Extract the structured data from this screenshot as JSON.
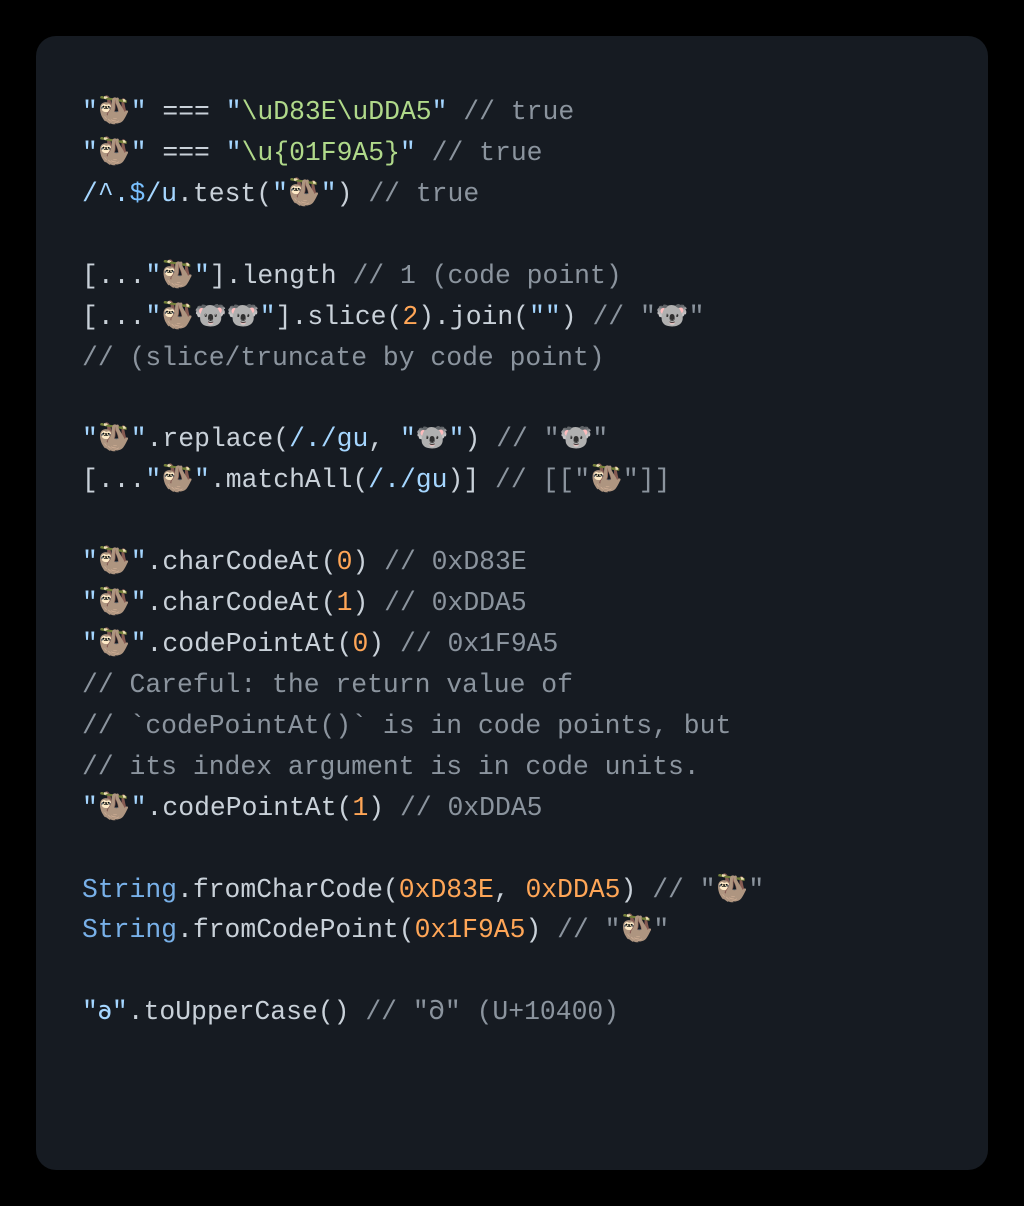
{
  "colors": {
    "bg_outer": "#000000",
    "bg_panel": "#161b22",
    "text_default": "#c9d1d9",
    "text_comment": "#8b949e",
    "text_string": "#a5d6ff",
    "text_escape": "#b0d98a",
    "text_number": "#ffa657",
    "text_constant": "#79c0ff",
    "text_class": "#78b0e8"
  },
  "lines": [
    [
      {
        "t": "str",
        "v": "\"🦥\""
      },
      {
        "t": "punct",
        "v": " === "
      },
      {
        "t": "str",
        "v": "\""
      },
      {
        "t": "esc",
        "v": "\\uD83E\\uDDA5"
      },
      {
        "t": "str",
        "v": "\""
      },
      {
        "t": "comment",
        "v": " // true"
      }
    ],
    [
      {
        "t": "str",
        "v": "\"🦥\""
      },
      {
        "t": "punct",
        "v": " === "
      },
      {
        "t": "str",
        "v": "\""
      },
      {
        "t": "esc",
        "v": "\\u{01F9A5}"
      },
      {
        "t": "str",
        "v": "\""
      },
      {
        "t": "comment",
        "v": " // true"
      }
    ],
    [
      {
        "t": "regex",
        "v": "/^."
      },
      {
        "t": "const",
        "v": "$"
      },
      {
        "t": "regex",
        "v": "/u"
      },
      {
        "t": "punct",
        "v": "."
      },
      {
        "t": "prop",
        "v": "test"
      },
      {
        "t": "punct",
        "v": "("
      },
      {
        "t": "str",
        "v": "\"🦥\""
      },
      {
        "t": "punct",
        "v": ")"
      },
      {
        "t": "comment",
        "v": " // true"
      }
    ],
    [],
    [
      {
        "t": "punct",
        "v": "[..."
      },
      {
        "t": "str",
        "v": "\"🦥\""
      },
      {
        "t": "punct",
        "v": "]."
      },
      {
        "t": "prop",
        "v": "length"
      },
      {
        "t": "comment",
        "v": " // 1 (code point)"
      }
    ],
    [
      {
        "t": "punct",
        "v": "[..."
      },
      {
        "t": "str",
        "v": "\"🦥🐨🐨\""
      },
      {
        "t": "punct",
        "v": "]."
      },
      {
        "t": "prop",
        "v": "slice"
      },
      {
        "t": "punct",
        "v": "("
      },
      {
        "t": "num",
        "v": "2"
      },
      {
        "t": "punct",
        "v": ")."
      },
      {
        "t": "prop",
        "v": "join"
      },
      {
        "t": "punct",
        "v": "("
      },
      {
        "t": "str",
        "v": "\"\""
      },
      {
        "t": "punct",
        "v": ")"
      },
      {
        "t": "comment",
        "v": " // \"🐨\""
      }
    ],
    [
      {
        "t": "comment",
        "v": "// (slice/truncate by code point)"
      }
    ],
    [],
    [
      {
        "t": "str",
        "v": "\"🦥\""
      },
      {
        "t": "punct",
        "v": "."
      },
      {
        "t": "prop",
        "v": "replace"
      },
      {
        "t": "punct",
        "v": "("
      },
      {
        "t": "regex",
        "v": "/./gu"
      },
      {
        "t": "punct",
        "v": ", "
      },
      {
        "t": "str",
        "v": "\"🐨\""
      },
      {
        "t": "punct",
        "v": ")"
      },
      {
        "t": "comment",
        "v": " // \"🐨\""
      }
    ],
    [
      {
        "t": "punct",
        "v": "[..."
      },
      {
        "t": "str",
        "v": "\"🦥\""
      },
      {
        "t": "punct",
        "v": "."
      },
      {
        "t": "prop",
        "v": "matchAll"
      },
      {
        "t": "punct",
        "v": "("
      },
      {
        "t": "regex",
        "v": "/./gu"
      },
      {
        "t": "punct",
        "v": ")]"
      },
      {
        "t": "comment",
        "v": " // [[\"🦥\"]]"
      }
    ],
    [],
    [
      {
        "t": "str",
        "v": "\"🦥\""
      },
      {
        "t": "punct",
        "v": "."
      },
      {
        "t": "prop",
        "v": "charCodeAt"
      },
      {
        "t": "punct",
        "v": "("
      },
      {
        "t": "num",
        "v": "0"
      },
      {
        "t": "punct",
        "v": ")"
      },
      {
        "t": "comment",
        "v": " // 0xD83E"
      }
    ],
    [
      {
        "t": "str",
        "v": "\"🦥\""
      },
      {
        "t": "punct",
        "v": "."
      },
      {
        "t": "prop",
        "v": "charCodeAt"
      },
      {
        "t": "punct",
        "v": "("
      },
      {
        "t": "num",
        "v": "1"
      },
      {
        "t": "punct",
        "v": ")"
      },
      {
        "t": "comment",
        "v": " // 0xDDA5"
      }
    ],
    [
      {
        "t": "str",
        "v": "\"🦥\""
      },
      {
        "t": "punct",
        "v": "."
      },
      {
        "t": "prop",
        "v": "codePointAt"
      },
      {
        "t": "punct",
        "v": "("
      },
      {
        "t": "num",
        "v": "0"
      },
      {
        "t": "punct",
        "v": ")"
      },
      {
        "t": "comment",
        "v": " // 0x1F9A5"
      }
    ],
    [
      {
        "t": "comment",
        "v": "// Careful: the return value of"
      }
    ],
    [
      {
        "t": "comment",
        "v": "// `codePointAt()` is in code points, but"
      }
    ],
    [
      {
        "t": "comment",
        "v": "// its index argument is in code units."
      }
    ],
    [
      {
        "t": "str",
        "v": "\"🦥\""
      },
      {
        "t": "punct",
        "v": "."
      },
      {
        "t": "prop",
        "v": "codePointAt"
      },
      {
        "t": "punct",
        "v": "("
      },
      {
        "t": "num",
        "v": "1"
      },
      {
        "t": "punct",
        "v": ")"
      },
      {
        "t": "comment",
        "v": " // 0xDDA5"
      }
    ],
    [],
    [
      {
        "t": "class",
        "v": "String"
      },
      {
        "t": "punct",
        "v": "."
      },
      {
        "t": "prop",
        "v": "fromCharCode"
      },
      {
        "t": "punct",
        "v": "("
      },
      {
        "t": "num",
        "v": "0xD83E"
      },
      {
        "t": "punct",
        "v": ", "
      },
      {
        "t": "num",
        "v": "0xDDA5"
      },
      {
        "t": "punct",
        "v": ")"
      },
      {
        "t": "comment",
        "v": " // \"🦥\""
      }
    ],
    [
      {
        "t": "class",
        "v": "String"
      },
      {
        "t": "punct",
        "v": "."
      },
      {
        "t": "prop",
        "v": "fromCodePoint"
      },
      {
        "t": "punct",
        "v": "("
      },
      {
        "t": "num",
        "v": "0x1F9A5"
      },
      {
        "t": "punct",
        "v": ")"
      },
      {
        "t": "comment",
        "v": " // \"🦥\""
      }
    ],
    [],
    [
      {
        "t": "str",
        "v": "\"𐐨\""
      },
      {
        "t": "punct",
        "v": "."
      },
      {
        "t": "prop",
        "v": "toUpperCase"
      },
      {
        "t": "punct",
        "v": "()"
      },
      {
        "t": "comment",
        "v": " // \"𐐀\" (U+10400)"
      }
    ]
  ]
}
